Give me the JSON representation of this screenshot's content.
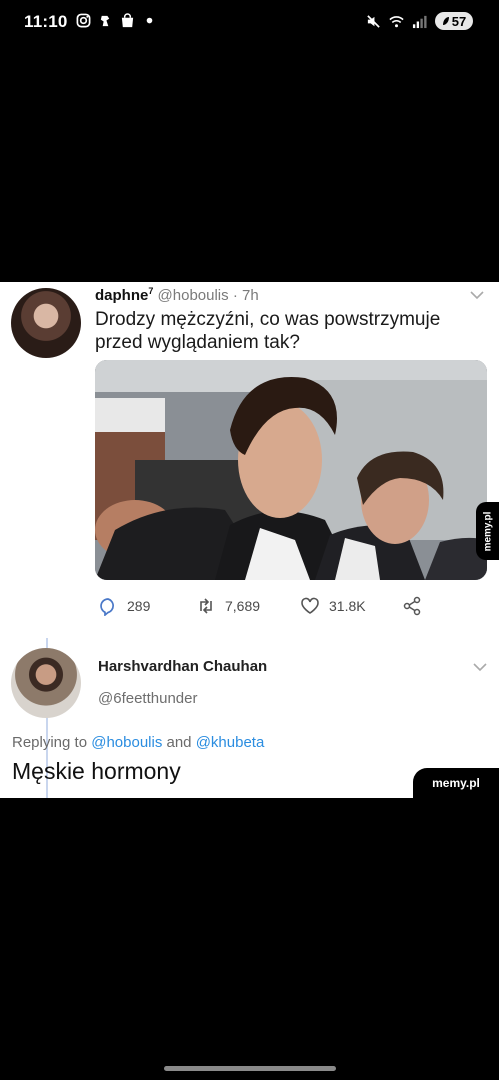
{
  "status_bar": {
    "time": "11:10",
    "left_icons": [
      "instagram-icon",
      "notification-app-icon",
      "shopping-bag-icon",
      "dot-icon"
    ],
    "right_icons": [
      "mute-icon",
      "wifi-icon",
      "signal-icon"
    ],
    "battery": "57"
  },
  "tweet": {
    "name": "daphne",
    "badge": "7",
    "handle": "@hoboulis",
    "time": "· 7h",
    "text": "Drodzy mężczyźni, co was powstrzymuje przed wyglądaniem tak?",
    "actions": {
      "replies": "289",
      "retweets": "7,689",
      "likes": "31.8K"
    }
  },
  "reply": {
    "name": "Harshvardhan Chauhan",
    "handle": "@6feetthunder",
    "replying_prefix": "Replying to",
    "mention_1": "@hoboulis",
    "and_word": "and",
    "mention_2": "@khubeta",
    "text": "Męskie hormony"
  },
  "watermarks": {
    "corner": "memy.pl",
    "side": "memy.pl"
  },
  "colors": {
    "mention": "#2b8de0",
    "thread_line": "#c9d6ee",
    "background": "#000000"
  }
}
